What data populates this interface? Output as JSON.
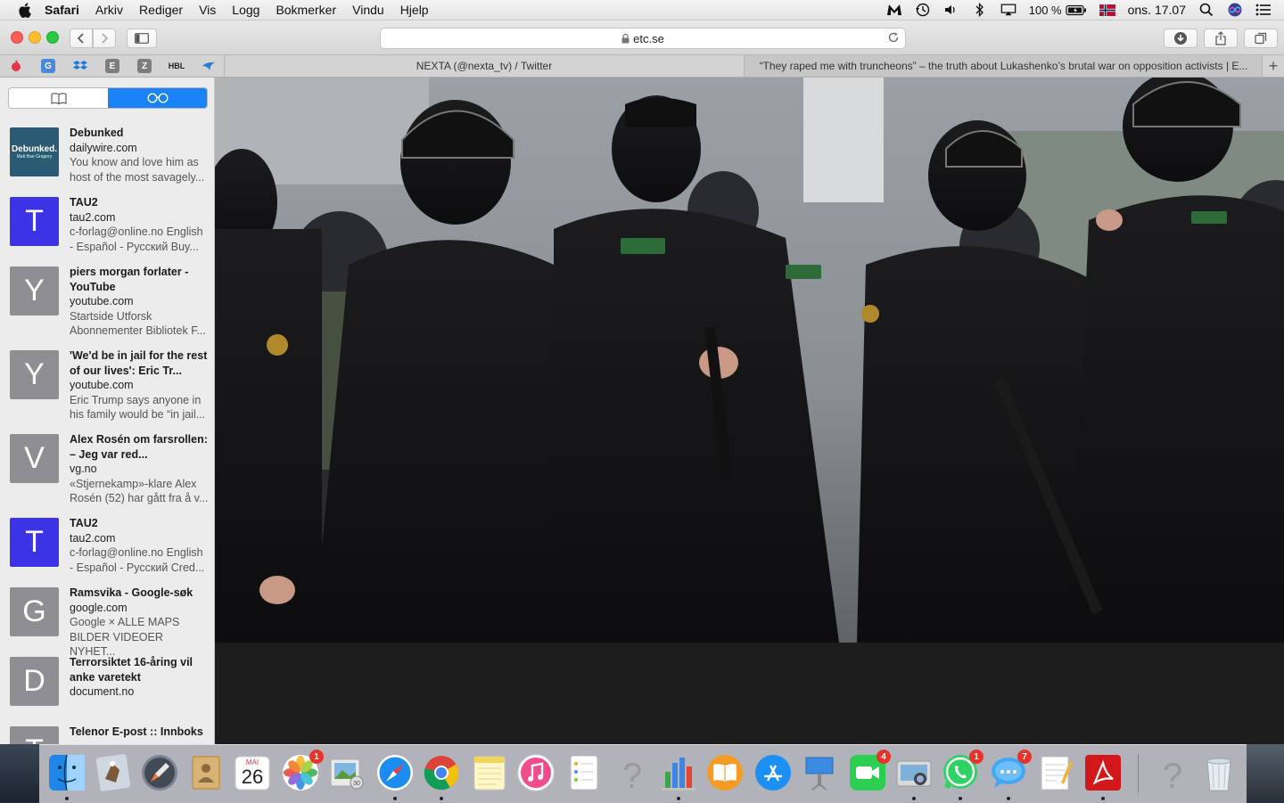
{
  "menubar": {
    "app_name": "Safari",
    "items": [
      "Arkiv",
      "Rediger",
      "Vis",
      "Logg",
      "Bokmerker",
      "Vindu",
      "Hjelp"
    ],
    "battery": "100 %",
    "clock": "ons. 17.07"
  },
  "toolbar": {
    "address": "etc.se"
  },
  "favorites": [
    {
      "icon": "flame-icon",
      "color": "#e8334a"
    },
    {
      "icon": "translate-icon",
      "label": "G",
      "color": "#4a89dc"
    },
    {
      "icon": "dropbox-icon",
      "color": "#1f7ae0"
    },
    {
      "icon": "e-icon",
      "label": "E",
      "color": "#7d7d7d"
    },
    {
      "icon": "z-icon",
      "label": "Z",
      "color": "#7d7d7d"
    },
    {
      "icon": "hbl-icon",
      "label": "HBL",
      "color": "#222222"
    },
    {
      "icon": "bird-icon",
      "color": "#2a7bd6"
    }
  ],
  "tabs": [
    {
      "label": "NEXTA (@nexta_tv) / Twitter",
      "active": false
    },
    {
      "label": "“They raped me with truncheons” – the truth about Lukashenko’s brutal war on opposition activists | E...",
      "active": true
    }
  ],
  "reading_list": [
    {
      "thumb": "Debunked.",
      "thumb_sub": "Matt Bae Gragery",
      "thumb_color": "#2b5a74",
      "title": "Debunked",
      "domain": "dailywire.com",
      "desc": "You know and love him as host of the most savagely..."
    },
    {
      "thumb": "T",
      "thumb_color": "#3c32e6",
      "title": "TAU2",
      "domain": "tau2.com",
      "desc": "c-forlag@online.no English - Español - Русский Buy..."
    },
    {
      "thumb": "Y",
      "thumb_color": "#8e8e93",
      "title": "piers morgan forlater - YouTube",
      "domain": "youtube.com",
      "desc": "Startside Utforsk Abonnementer Bibliotek F..."
    },
    {
      "thumb": "Y",
      "thumb_color": "#8e8e93",
      "title": "'We'd be in jail for the rest of our lives': Eric Tr...",
      "domain": "youtube.com",
      "desc": "Eric Trump says anyone in his family would be “in jail..."
    },
    {
      "thumb": "V",
      "thumb_color": "#8e8e93",
      "title": "Alex Rosén om farsrollen: – Jeg var red...",
      "domain": "vg.no",
      "desc": "«Stjernekamp»-klare Alex Rosén (52) har gått fra å v..."
    },
    {
      "thumb": "T",
      "thumb_color": "#3c32e6",
      "title": "TAU2",
      "domain": "tau2.com",
      "desc": "c-forlag@online.no English - Español - Русский Cred..."
    },
    {
      "thumb": "G",
      "thumb_color": "#8e8e93",
      "title": "Ramsvika - Google-søk",
      "domain": "google.com",
      "desc": "Google × ALLE MAPS BILDER VIDEOER NYHET..."
    },
    {
      "thumb": "D",
      "thumb_color": "#8e8e93",
      "title": "Terrorsiktet 16-åring vil anke varetekt",
      "domain": "document.no",
      "desc": ""
    },
    {
      "thumb": "T",
      "thumb_color": "#8e8e93",
      "title": "Telenor E-post :: Innboks",
      "domain": "",
      "desc": ""
    }
  ],
  "dock": {
    "calendar": {
      "month": "MAI",
      "day": "26"
    },
    "apps": [
      {
        "name": "finder-icon",
        "running": true
      },
      {
        "name": "preview-eagle-icon",
        "running": false
      },
      {
        "name": "launchpad-icon",
        "running": false
      },
      {
        "name": "contacts-icon",
        "running": false
      },
      {
        "name": "calendar-icon",
        "running": false
      },
      {
        "name": "photos-icon",
        "running": false,
        "badge": "1"
      },
      {
        "name": "preview-icon",
        "running": false
      },
      {
        "name": "safari-icon",
        "running": true
      },
      {
        "name": "chrome-icon",
        "running": true
      },
      {
        "name": "notes-icon",
        "running": false
      },
      {
        "name": "itunes-icon",
        "running": false
      },
      {
        "name": "reminders-icon",
        "running": false
      },
      {
        "name": "unknown-app-icon",
        "running": false
      },
      {
        "name": "numbers-icon",
        "running": true
      },
      {
        "name": "ibooks-icon",
        "running": false
      },
      {
        "name": "app-store-icon",
        "running": false
      },
      {
        "name": "keynote-icon",
        "running": false
      },
      {
        "name": "facetime-icon",
        "running": false,
        "badge": "4"
      },
      {
        "name": "image-capture-icon",
        "running": true
      },
      {
        "name": "whatsapp-icon",
        "running": true,
        "badge": "1"
      },
      {
        "name": "messages-icon",
        "running": true,
        "badge": "7"
      },
      {
        "name": "textedit-icon",
        "running": false
      },
      {
        "name": "acrobat-icon",
        "running": true
      },
      {
        "name": "unknown-app-icon-2",
        "running": false
      },
      {
        "name": "trash-icon",
        "running": false
      }
    ]
  }
}
